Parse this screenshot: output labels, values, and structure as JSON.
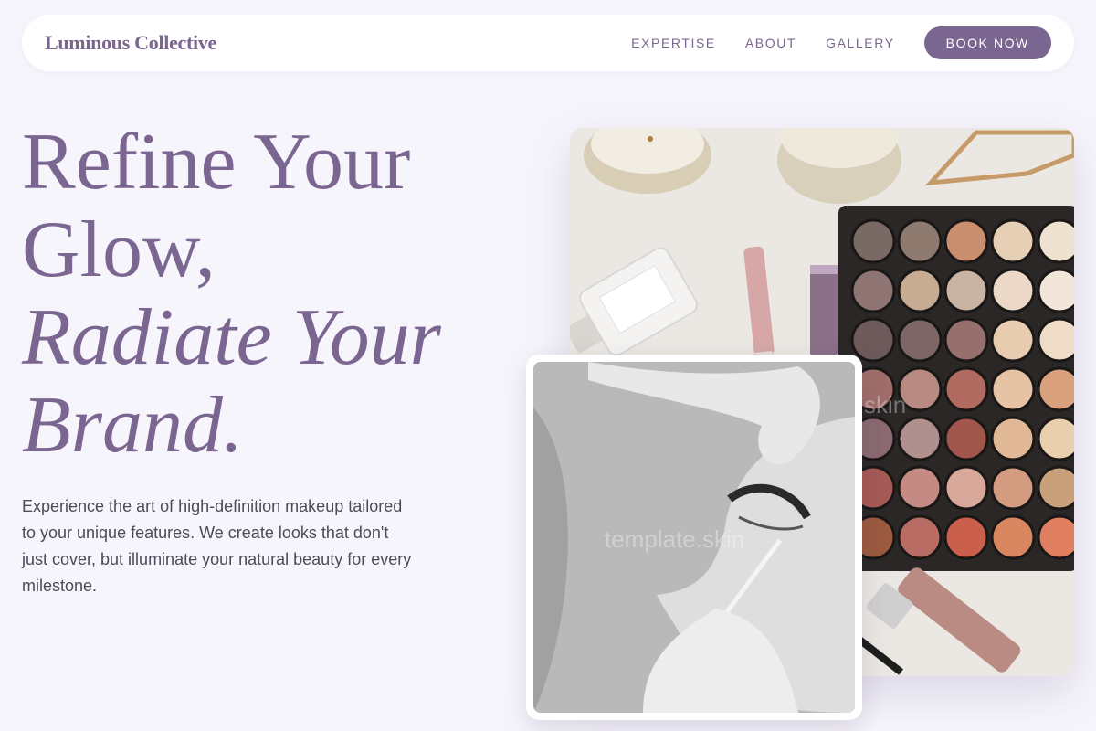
{
  "nav": {
    "brand": "Luminous Collective",
    "links": [
      "EXPERTISE",
      "ABOUT",
      "GALLERY"
    ],
    "cta": "BOOK NOW"
  },
  "hero": {
    "title_lines": [
      "Refine Your",
      "Glow,"
    ],
    "title_italic_lines": [
      "Radiate Your",
      "Brand."
    ],
    "description": "Experience the art of high-definition makeup tailored to your unique features. We create looks that don't just cover, but illuminate your natural beauty for every milestone."
  },
  "images": {
    "product_watermark": "skin",
    "portrait_watermark": "template.skin"
  },
  "colors": {
    "accent": "#7a6690",
    "background": "#f7f5fc",
    "text": "#4d4a5a"
  }
}
